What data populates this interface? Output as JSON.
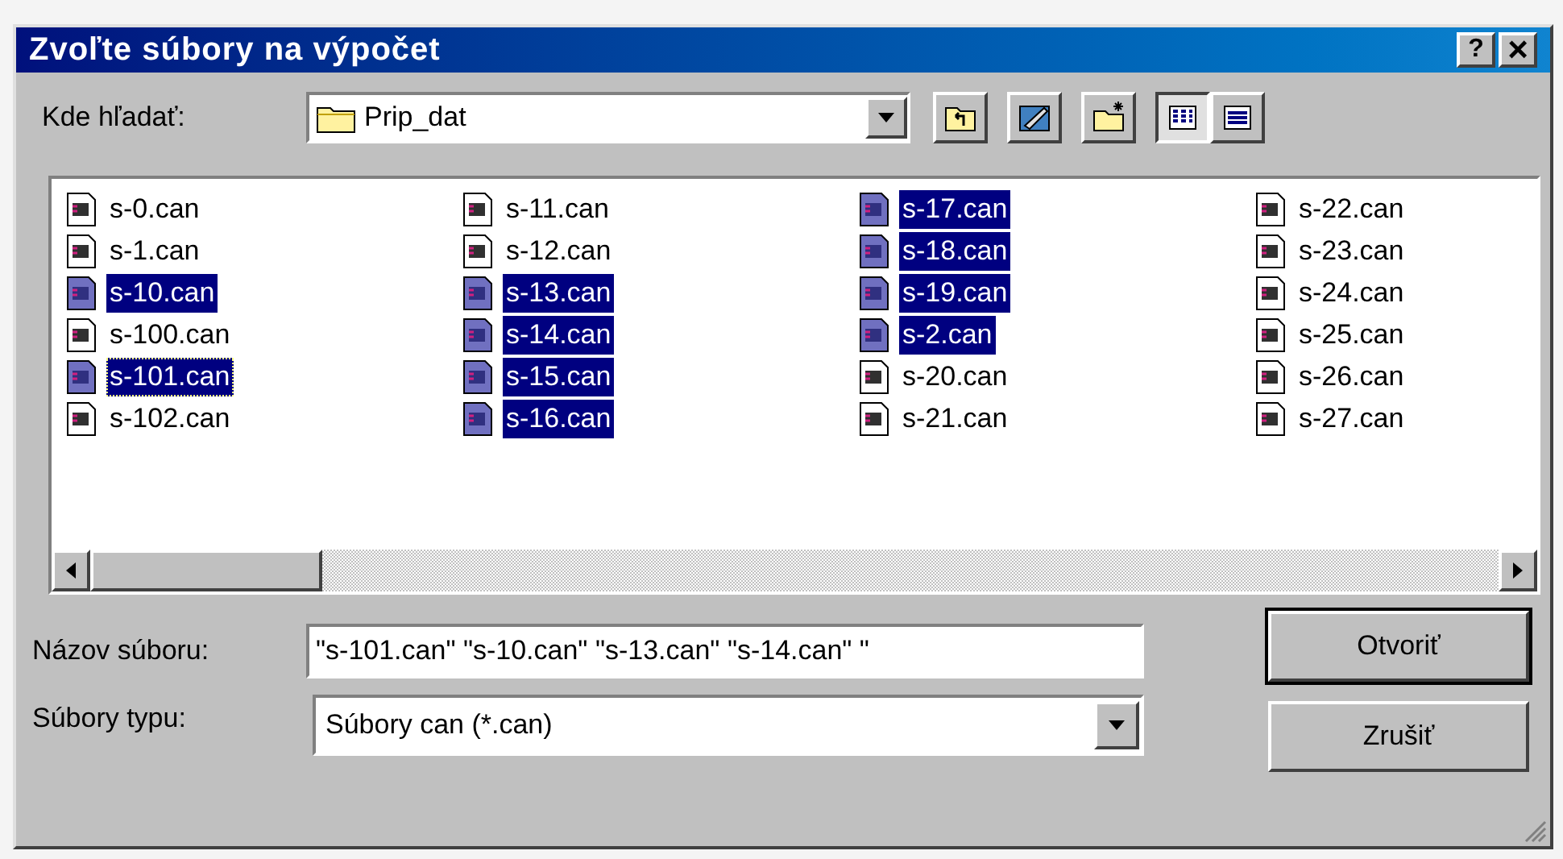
{
  "window": {
    "title": "Zvoľte súbory na výpočet",
    "help": "?",
    "close": "×"
  },
  "look_in": {
    "label": "Kde hľadať:",
    "value": "Prip_dat"
  },
  "toolbar": [
    {
      "kind": "up",
      "selected": false
    },
    {
      "kind": "desktop",
      "selected": false
    },
    {
      "kind": "new-folder",
      "selected": false
    },
    {
      "kind": "list",
      "selected": true
    },
    {
      "kind": "details",
      "selected": false
    }
  ],
  "files": [
    {
      "name": "s-0.can",
      "selected": false,
      "focused": false
    },
    {
      "name": "s-1.can",
      "selected": false,
      "focused": false
    },
    {
      "name": "s-10.can",
      "selected": true,
      "focused": false
    },
    {
      "name": "s-100.can",
      "selected": false,
      "focused": false
    },
    {
      "name": "s-101.can",
      "selected": true,
      "focused": true
    },
    {
      "name": "s-102.can",
      "selected": false,
      "focused": false
    },
    {
      "name": "s-11.can",
      "selected": false,
      "focused": false
    },
    {
      "name": "s-12.can",
      "selected": false,
      "focused": false
    },
    {
      "name": "s-13.can",
      "selected": true,
      "focused": false
    },
    {
      "name": "s-14.can",
      "selected": true,
      "focused": false
    },
    {
      "name": "s-15.can",
      "selected": true,
      "focused": false
    },
    {
      "name": "s-16.can",
      "selected": true,
      "focused": false
    },
    {
      "name": "s-17.can",
      "selected": true,
      "focused": false
    },
    {
      "name": "s-18.can",
      "selected": true,
      "focused": false
    },
    {
      "name": "s-19.can",
      "selected": true,
      "focused": false
    },
    {
      "name": "s-2.can",
      "selected": true,
      "focused": false
    },
    {
      "name": "s-20.can",
      "selected": false,
      "focused": false
    },
    {
      "name": "s-21.can",
      "selected": false,
      "focused": false
    },
    {
      "name": "s-22.can",
      "selected": false,
      "focused": false
    },
    {
      "name": "s-23.can",
      "selected": false,
      "focused": false
    },
    {
      "name": "s-24.can",
      "selected": false,
      "focused": false
    },
    {
      "name": "s-25.can",
      "selected": false,
      "focused": false
    },
    {
      "name": "s-26.can",
      "selected": false,
      "focused": false
    },
    {
      "name": "s-27.can",
      "selected": false,
      "focused": false
    }
  ],
  "file_name": {
    "label": "Názov súboru:",
    "value": "\"s-101.can\" \"s-10.can\" \"s-13.can\" \"s-14.can\" \""
  },
  "file_type": {
    "label": "Súbory typu:",
    "value": "Súbory can (*.can)"
  },
  "buttons": [
    {
      "label": "Otvoriť",
      "default": true
    },
    {
      "label": "Zrušiť",
      "default": false
    }
  ]
}
